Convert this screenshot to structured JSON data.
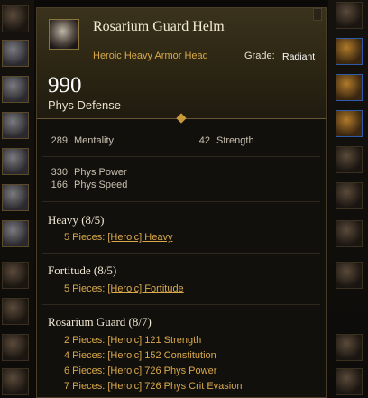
{
  "item": {
    "name": "Rosarium Guard Helm",
    "subtitle": "Heroic Heavy Armor Head",
    "grade_label": "Grade:",
    "grade_value": "Radiant",
    "defense_value": "990",
    "defense_label": "Phys Defense",
    "icon": "helm-icon"
  },
  "stats": [
    {
      "value": "289",
      "label": "Mentality"
    },
    {
      "value": "42",
      "label": "Strength"
    },
    {
      "value": "330",
      "label": "Phys Power"
    },
    {
      "value": "166",
      "label": "Phys Speed"
    }
  ],
  "sets": [
    {
      "title": "Heavy",
      "count": "(8/5)",
      "lines": [
        {
          "pieces": "5 Pieces:",
          "effect": "[Heroic] Heavy"
        }
      ]
    },
    {
      "title": "Fortitude",
      "count": "(8/5)",
      "lines": [
        {
          "pieces": "5 Pieces:",
          "effect": "[Heroic] Fortitude"
        }
      ]
    },
    {
      "title": "Rosarium Guard",
      "count": "(8/7)",
      "lines": [
        {
          "pieces": "2 Pieces:",
          "effect": "[Heroic] 121 Strength"
        },
        {
          "pieces": "4 Pieces:",
          "effect": "[Heroic] 152 Constitution"
        },
        {
          "pieces": "6 Pieces:",
          "effect": "[Heroic] 726 Phys Power"
        },
        {
          "pieces": "7 Pieces:",
          "effect": "[Heroic] 726 Phys Crit Evasion"
        }
      ]
    }
  ],
  "colors": {
    "accent_gold": "#d9a94a",
    "header_bg": "#3a321c",
    "text_light": "#f0e8d4"
  }
}
